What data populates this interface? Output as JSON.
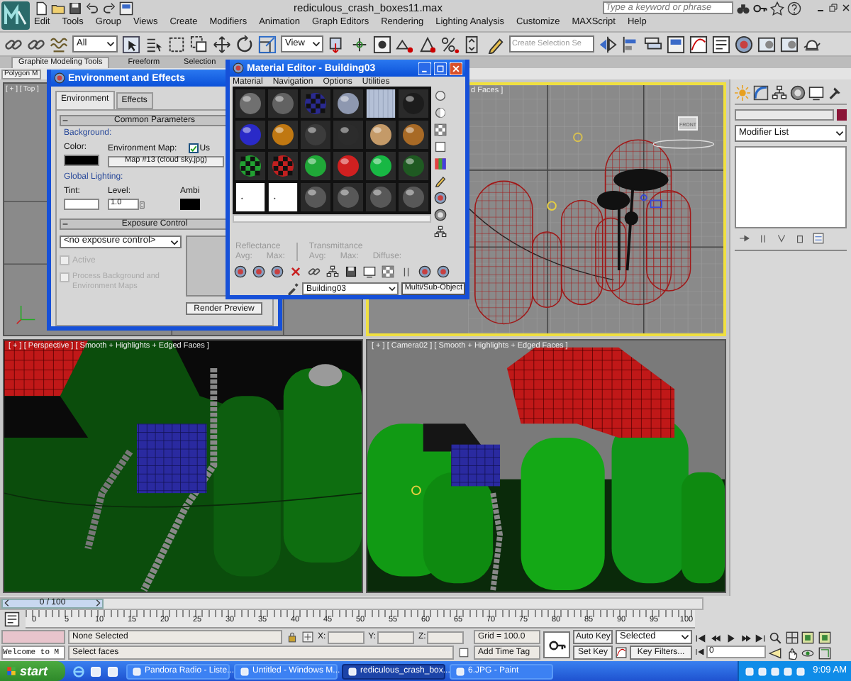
{
  "app": {
    "title": "rediculous_crash_boxes11.max",
    "search": {
      "placeholder": "Type a keyword or phrase"
    }
  },
  "menu": [
    "Edit",
    "Tools",
    "Group",
    "Views",
    "Create",
    "Modifiers",
    "Animation",
    "Graph Editors",
    "Rendering",
    "Lighting Analysis",
    "Customize",
    "MAXScript",
    "Help"
  ],
  "toolbar": {
    "filter": "All",
    "coord": "View",
    "selection_set": {
      "placeholder": "Create Selection Se"
    }
  },
  "ribbon": {
    "tabs": [
      {
        "label": "Graphite Modeling Tools",
        "selected": true
      },
      {
        "label": "Freeform",
        "selected": false
      },
      {
        "label": "Selection",
        "selected": false
      }
    ],
    "panel": "Polygon M"
  },
  "viewports": [
    {
      "label": "[ + ] [ Top ]",
      "kind": "top",
      "active": false
    },
    {
      "label": "d Faces ]",
      "kind": "front",
      "active": true,
      "viewcube": "FRONT"
    },
    {
      "label": "[ + ] [ Perspective ] [ Smooth + Highlights + Edged Faces ]",
      "kind": "perspective",
      "active": false
    },
    {
      "label": "[ + ] [ Camera02 ] [ Smooth + Highlights + Edged Faces ]",
      "kind": "camera",
      "active": false
    }
  ],
  "command_panel": {
    "modifier_list": "Modifier List"
  },
  "environment": {
    "title": "Environment and Effects",
    "tabs": [
      {
        "label": "Environment",
        "selected": true
      },
      {
        "label": "Effects",
        "selected": false
      }
    ],
    "common": {
      "heading": "Common Parameters",
      "background": "Background:",
      "color_label": "Color:",
      "map_label": "Environment Map:",
      "use_map": {
        "label": "Us",
        "checked": true
      },
      "map_button": "Map #13 (cloud sky.jpg)",
      "global": "Global Lighting:",
      "tint": "Tint:",
      "level": "Level:",
      "level_value": "1.0",
      "ambient": "Ambi"
    },
    "exposure": {
      "heading": "Exposure Control",
      "dropdown": "<no exposure control>",
      "active": {
        "label": "Active",
        "checked": false,
        "disabled": true
      },
      "process": {
        "label": "Process Background and Environment Maps",
        "checked": false,
        "disabled": true
      },
      "render_preview": "Render Preview"
    }
  },
  "material_editor": {
    "title": "Material Editor - Building03",
    "menu": [
      "Material",
      "Navigation",
      "Options",
      "Utilities"
    ],
    "slots": [
      {
        "kind": "sphere",
        "color": "#707070"
      },
      {
        "kind": "sphere",
        "color": "#626262"
      },
      {
        "kind": "checker",
        "color": "#2a2a90"
      },
      {
        "kind": "sphere",
        "color": "#8e98b0"
      },
      {
        "kind": "flat",
        "color": "#b4c0d6"
      },
      {
        "kind": "sphere",
        "color": "#1c1c1c"
      },
      {
        "kind": "sphere",
        "color": "#2a2ac8"
      },
      {
        "kind": "sphere",
        "color": "#c07812"
      },
      {
        "kind": "sphere",
        "color": "#3c3c3c"
      },
      {
        "kind": "sphere",
        "color": "#2c2c2c"
      },
      {
        "kind": "sphere",
        "color": "#c49a68"
      },
      {
        "kind": "sphere",
        "color": "#a86a26"
      },
      {
        "kind": "checker",
        "color": "#22a032"
      },
      {
        "kind": "checker",
        "color": "#c02020"
      },
      {
        "kind": "sphere",
        "color": "#20a838"
      },
      {
        "kind": "sphere",
        "color": "#d02020"
      },
      {
        "kind": "sphere",
        "color": "#18b844"
      },
      {
        "kind": "sphere",
        "color": "#1f5a22"
      },
      {
        "kind": "blank",
        "color": "#ffffff"
      },
      {
        "kind": "blank",
        "color": "#ffffff"
      },
      {
        "kind": "sphere",
        "color": "#585858"
      },
      {
        "kind": "sphere",
        "color": "#585858"
      },
      {
        "kind": "sphere",
        "color": "#585858"
      },
      {
        "kind": "sphere",
        "color": "#585858"
      }
    ],
    "reflectance": {
      "heading": "Reflectance",
      "labels": [
        "Avg:",
        "Max:"
      ]
    },
    "transmittance": {
      "heading": "Transmittance",
      "labels": [
        "Avg:",
        "Max:",
        "Diffuse:"
      ]
    },
    "name": "Building03",
    "type_button": "Multi/Sub-Object"
  },
  "time_slider": {
    "position": "0 / 100",
    "level": 0
  },
  "trackbar": {
    "ticks": [
      "0",
      "5",
      "10",
      "15",
      "20",
      "25",
      "30",
      "35",
      "40",
      "45",
      "50",
      "55",
      "60",
      "65",
      "70",
      "75",
      "80",
      "85",
      "90",
      "95",
      "100"
    ]
  },
  "status": {
    "script_field": "Welcome to M",
    "selection": "None Selected",
    "prompt": "Select faces",
    "coords": [
      "X:",
      "Y:",
      "Z:"
    ],
    "grid": "Grid = 100.0",
    "time_tag": "Add Time Tag",
    "auto_key": "Auto Key",
    "set_key": "Set Key",
    "key_mode": "Selected",
    "key_filters": "Key Filters...",
    "frame": "0"
  },
  "taskbar": {
    "start": "start",
    "tasks": [
      {
        "label": "Pandora Radio - Liste...",
        "selected": false
      },
      {
        "label": "Untitled - Windows M...",
        "selected": false
      },
      {
        "label": "rediculous_crash_box...",
        "selected": true
      },
      {
        "label": "6.JPG - Paint",
        "selected": false
      }
    ],
    "clock": "9:09 AM"
  }
}
